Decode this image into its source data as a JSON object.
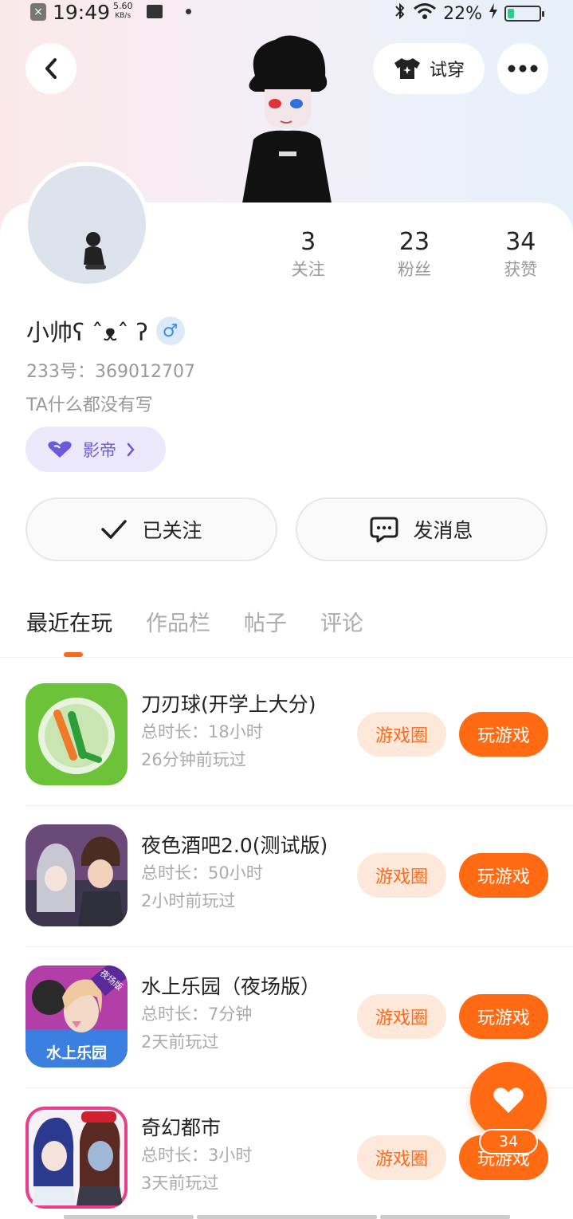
{
  "status_bar": {
    "time": "19:49",
    "speed": "5.60",
    "speed_unit": "KB/s",
    "battery": "22%",
    "battery_level": 0.22
  },
  "header": {
    "tryon_label": "试穿"
  },
  "profile": {
    "name": "小帅ʕ ˆᴥˆ ʔ",
    "gender_symbol": "♂",
    "id_line": "233号：369012707",
    "bio": "TA什么都没有写",
    "badge_label": "影帝",
    "stats": [
      {
        "value": "3",
        "label": "关注"
      },
      {
        "value": "23",
        "label": "粉丝"
      },
      {
        "value": "34",
        "label": "获赞"
      }
    ]
  },
  "actions": {
    "follow_label": "已关注",
    "message_label": "发消息"
  },
  "tabs": [
    "最近在玩",
    "作品栏",
    "帖子",
    "评论"
  ],
  "games": [
    {
      "title": "刀刃球(开学上大分)",
      "duration": "总时长：18小时",
      "last_played": "26分钟前玩过"
    },
    {
      "title": "夜色酒吧2.0(测试版)",
      "duration": "总时长：50小时",
      "last_played": "2小时前玩过"
    },
    {
      "title": "水上乐园（夜场版）",
      "duration": "总时长：7分钟",
      "last_played": "2天前玩过",
      "icon_text": "水上乐园",
      "icon_tag": "夜场版"
    },
    {
      "title": "奇幻都市",
      "duration": "总时长：3小时",
      "last_played": "3天前玩过"
    }
  ],
  "game_buttons": {
    "circle_label": "游戏圈",
    "play_label": "玩游戏"
  },
  "like": {
    "count": "34"
  },
  "colors": {
    "accent": "#ff6a12",
    "accent_light": "#fde8da",
    "badge_purple": "#6a5ae0"
  }
}
